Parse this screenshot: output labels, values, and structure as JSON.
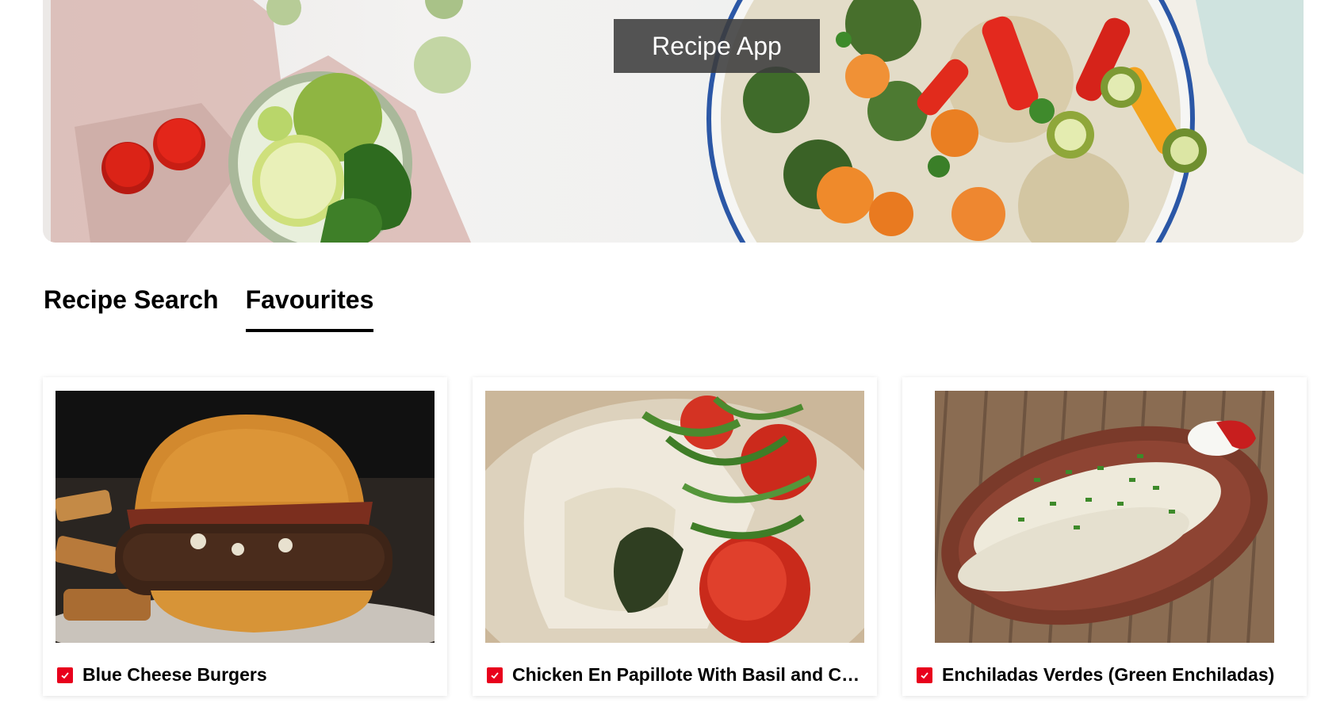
{
  "header": {
    "title": "Recipe App"
  },
  "tabs": [
    {
      "label": "Recipe Search",
      "active": false
    },
    {
      "label": "Favourites",
      "active": true
    }
  ],
  "favourites": [
    {
      "title": "Blue Cheese Burgers",
      "favourited": true
    },
    {
      "title": "Chicken En Papillote With Basil and Cherry Tomatoes",
      "favourited": true
    },
    {
      "title": "Enchiladas Verdes (Green Enchiladas)",
      "favourited": true
    }
  ],
  "colors": {
    "accent": "#e8001c",
    "title_banner": "#3c3c3c"
  },
  "icons": {
    "favourite": "checkbox-checked-icon"
  }
}
